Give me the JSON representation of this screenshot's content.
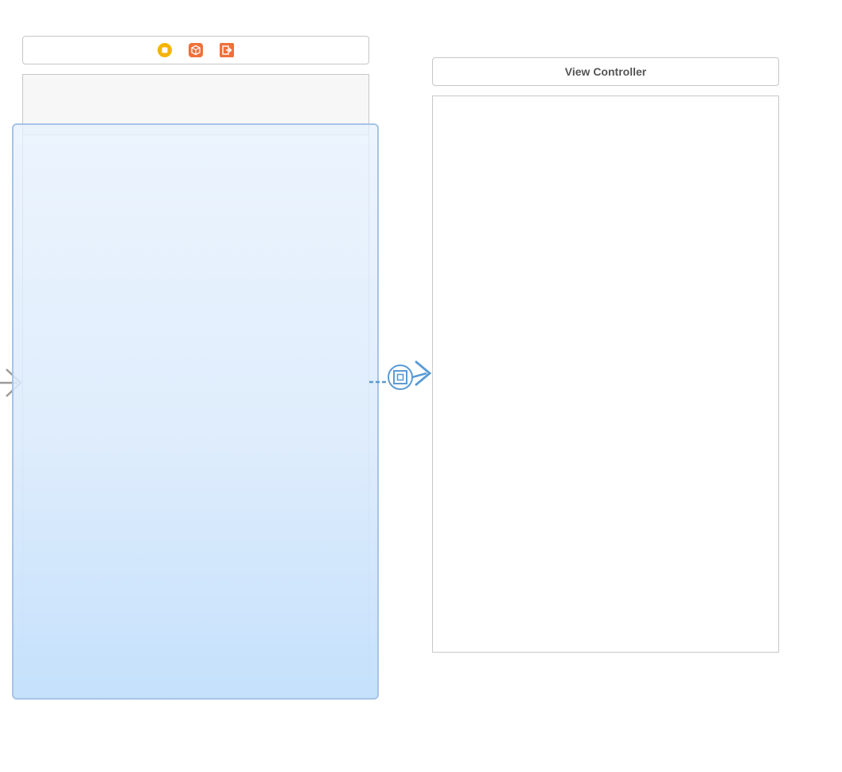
{
  "navigation_scene": {
    "dock_icons": [
      {
        "name": "navigation-controller-icon",
        "color": "#f4b400"
      },
      {
        "name": "first-responder-icon",
        "color": "#f0703a"
      },
      {
        "name": "exit-icon",
        "color": "#f0703a"
      }
    ],
    "selected": true,
    "selection_color": "#a6c4e6"
  },
  "view_controller_scene": {
    "title": "View Controller"
  },
  "segue": {
    "type": "root-view-controller-relationship",
    "color": "#5b9bd5"
  },
  "entry_point": {
    "icon": "initial-view-controller-arrow",
    "color": "#9a9a9a"
  }
}
